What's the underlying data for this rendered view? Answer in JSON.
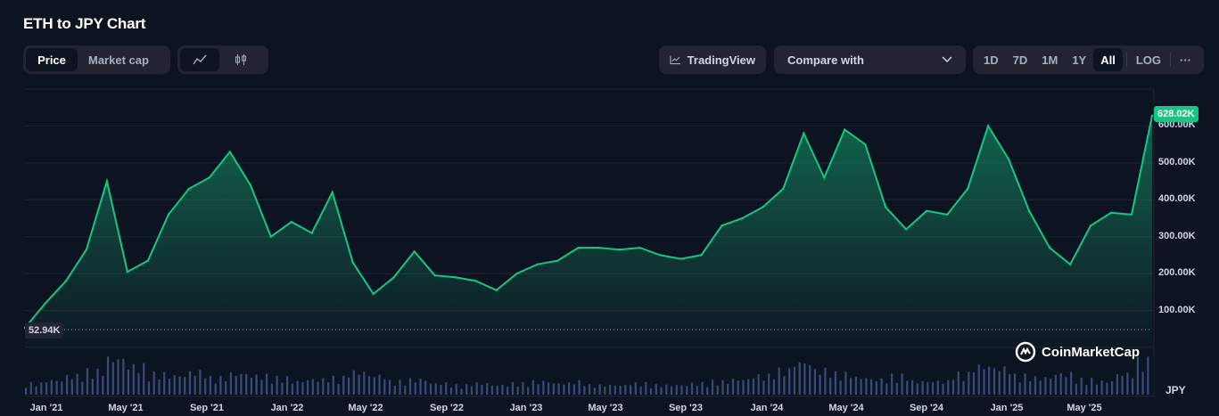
{
  "title": "ETH to JPY Chart",
  "toolbar": {
    "price_label": "Price",
    "market_cap_label": "Market cap",
    "line_icon": "line-chart-icon",
    "candle_icon": "candlestick-icon",
    "tradingview_label": "TradingView",
    "compare_label": "Compare with",
    "ranges": [
      "1D",
      "7D",
      "1M",
      "1Y",
      "All"
    ],
    "active_range": "All",
    "log_label": "LOG",
    "more_label": "···"
  },
  "current_price_label": "628.02K",
  "min_price_label": "52.94K",
  "currency_label": "JPY",
  "brand": "CoinMarketCap",
  "colors": {
    "line": "#16c784",
    "volume": "#3c4a7a",
    "background": "#0d1421"
  },
  "chart_data": {
    "type": "line",
    "title": "ETH to JPY Chart",
    "x": [
      "2021-01",
      "2021-02",
      "2021-03",
      "2021-04",
      "2021-05",
      "2021-06",
      "2021-07",
      "2021-08",
      "2021-09",
      "2021-10",
      "2021-11",
      "2021-12",
      "2022-01",
      "2022-02",
      "2022-03",
      "2022-04",
      "2022-05",
      "2022-06",
      "2022-07",
      "2022-08",
      "2022-09",
      "2022-10",
      "2022-11",
      "2022-12",
      "2023-01",
      "2023-02",
      "2023-03",
      "2023-04",
      "2023-05",
      "2023-06",
      "2023-07",
      "2023-08",
      "2023-09",
      "2023-10",
      "2023-11",
      "2023-12",
      "2024-01",
      "2024-02",
      "2024-03",
      "2024-04",
      "2024-05",
      "2024-06",
      "2024-07",
      "2024-08",
      "2024-09",
      "2024-10",
      "2024-11",
      "2024-12",
      "2025-01",
      "2025-02",
      "2025-03",
      "2025-04",
      "2025-05",
      "2025-06",
      "2025-07",
      "2025-08"
    ],
    "series": [
      {
        "values": [
          53000,
          120000,
          180000,
          265000,
          450000,
          205000,
          235000,
          360000,
          430000,
          460000,
          530000,
          440000,
          300000,
          340000,
          310000,
          420000,
          230000,
          145000,
          190000,
          260000,
          195000,
          190000,
          180000,
          155000,
          200000,
          225000,
          235000,
          270000,
          270000,
          265000,
          270000,
          250000,
          240000,
          250000,
          330000,
          350000,
          380000,
          430000,
          580000,
          460000,
          590000,
          550000,
          380000,
          320000,
          370000,
          360000,
          430000,
          600000,
          510000,
          370000,
          270000,
          225000,
          330000,
          365000,
          360000,
          628020
        ]
      }
    ],
    "y_ticks": [
      "100.00K",
      "200.00K",
      "300.00K",
      "400.00K",
      "500.00K",
      "600.00K"
    ],
    "x_ticks": [
      "Jan '21",
      "May '21",
      "Sep '21",
      "Jan '22",
      "May '22",
      "Sep '22",
      "Jan '23",
      "May '23",
      "Sep '23",
      "Jan '24",
      "May '24",
      "Sep '24",
      "Jan '25",
      "May '25"
    ],
    "ylim": [
      0,
      700000
    ],
    "volume": [
      12,
      15,
      20,
      25,
      38,
      30,
      22,
      20,
      24,
      18,
      22,
      20,
      18,
      14,
      16,
      18,
      24,
      20,
      14,
      16,
      12,
      10,
      12,
      10,
      12,
      14,
      12,
      14,
      10,
      10,
      12,
      10,
      10,
      12,
      14,
      16,
      20,
      26,
      34,
      26,
      22,
      18,
      16,
      20,
      14,
      14,
      22,
      30,
      28,
      20,
      18,
      22,
      16,
      14,
      22,
      36
    ],
    "volume_unit": "relative",
    "grid": true
  }
}
